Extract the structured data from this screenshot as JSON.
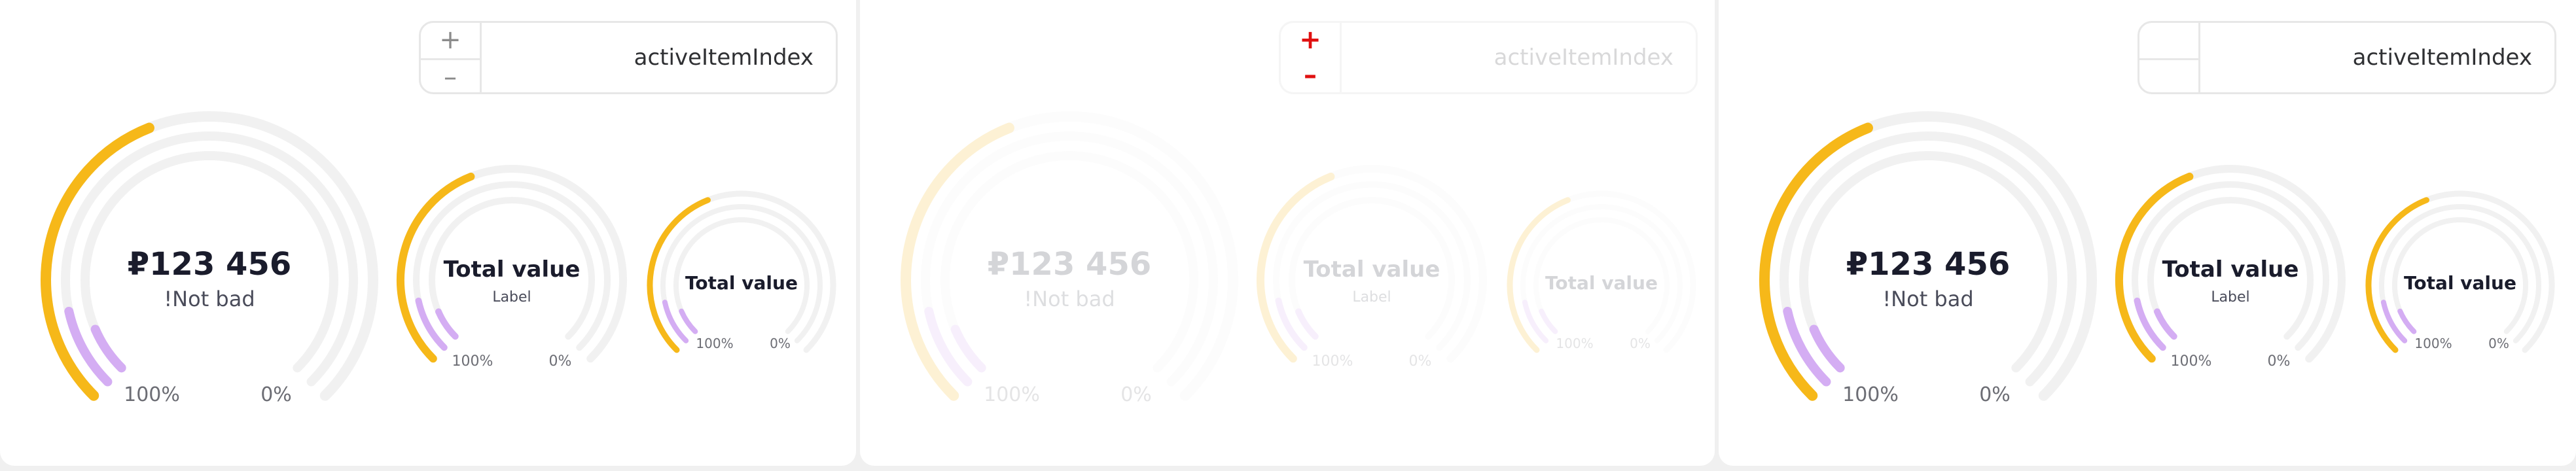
{
  "colors": {
    "track": "#f1f1f1",
    "accent": "#f6b819",
    "secondary": "#d4adf3",
    "panel": "#ffffff",
    "background": "#f0f0f0",
    "stepper_active": "#e01010"
  },
  "panels": [
    {
      "state": "default",
      "control": {
        "plus": "+",
        "minus": "–",
        "field_label": "activeItemIndex"
      },
      "gauges": [
        {
          "value": "₽123 456",
          "label": "!Not bad",
          "max_label": "100%",
          "min_label": "0%",
          "progress": [
            0.42,
            0.12,
            0.08
          ]
        },
        {
          "value": "Total value",
          "label": "Label",
          "max_label": "100%",
          "min_label": "0%",
          "progress": [
            0.42,
            0.12,
            0.08
          ]
        },
        {
          "value": "Total value",
          "label": "",
          "max_label": "100%",
          "min_label": "0%",
          "progress": [
            0.42,
            0.12,
            0.08
          ]
        }
      ]
    },
    {
      "state": "disabled",
      "control": {
        "plus": "+",
        "minus": "–",
        "field_label": "activeItemIndex"
      },
      "gauges": [
        {
          "value": "₽123 456",
          "label": "!Not bad",
          "max_label": "100%",
          "min_label": "0%",
          "progress": [
            0.42,
            0.12,
            0.08
          ]
        },
        {
          "value": "Total value",
          "label": "Label",
          "max_label": "100%",
          "min_label": "0%",
          "progress": [
            0.42,
            0.12,
            0.08
          ]
        },
        {
          "value": "Total value",
          "label": "",
          "max_label": "100%",
          "min_label": "0%",
          "progress": [
            0.42,
            0.12,
            0.08
          ]
        }
      ]
    },
    {
      "state": "default",
      "control": {
        "plus": "",
        "minus": "",
        "field_label": "activeItemIndex"
      },
      "gauges": [
        {
          "value": "₽123 456",
          "label": "!Not bad",
          "max_label": "100%",
          "min_label": "0%",
          "progress": [
            0.42,
            0.12,
            0.08
          ]
        },
        {
          "value": "Total value",
          "label": "Label",
          "max_label": "100%",
          "min_label": "0%",
          "progress": [
            0.42,
            0.12,
            0.08
          ]
        },
        {
          "value": "Total value",
          "label": "",
          "max_label": "100%",
          "min_label": "0%",
          "progress": [
            0.42,
            0.12,
            0.08
          ]
        }
      ]
    }
  ]
}
